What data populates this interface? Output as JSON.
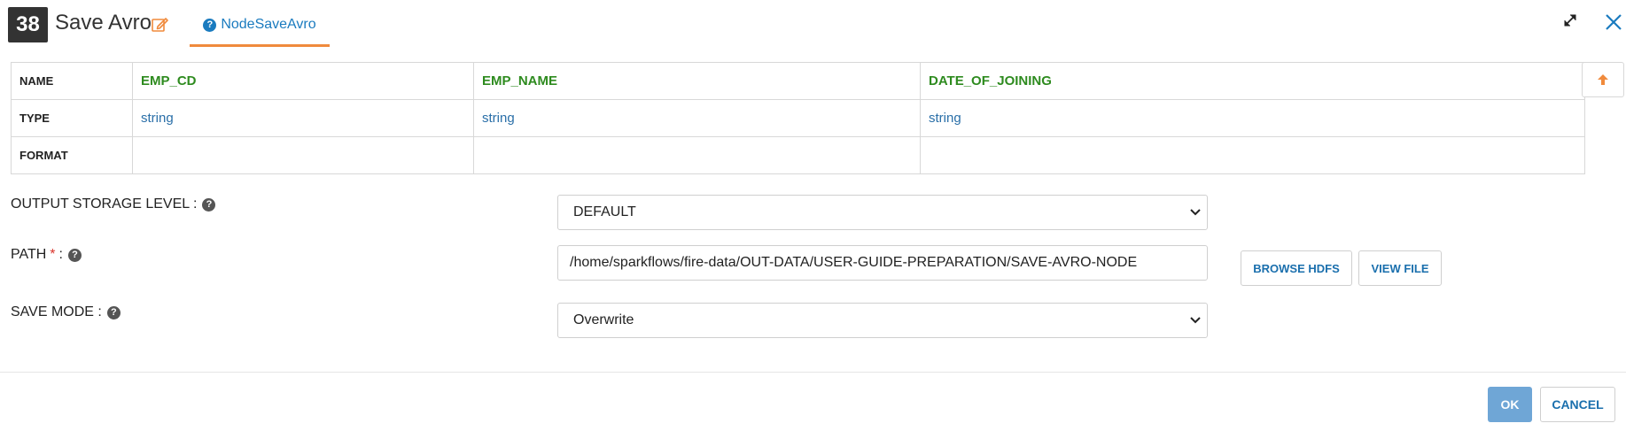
{
  "header": {
    "node_number": "38",
    "node_title": "Save Avro",
    "tab_label": "NodeSaveAvro"
  },
  "schema": {
    "row_labels": [
      "NAME",
      "TYPE",
      "FORMAT"
    ],
    "columns": [
      {
        "name": "EMP_CD",
        "type": "string",
        "format": ""
      },
      {
        "name": "EMP_NAME",
        "type": "string",
        "format": ""
      },
      {
        "name": "DATE_OF_JOINING",
        "type": "string",
        "format": ""
      }
    ]
  },
  "form": {
    "storage_level": {
      "label": "OUTPUT STORAGE LEVEL :",
      "value": "DEFAULT"
    },
    "path": {
      "label": "PATH",
      "required_mark": "*",
      "suffix": ":",
      "value": "/home/sparkflows/fire-data/OUT-DATA/USER-GUIDE-PREPARATION/SAVE-AVRO-NODE"
    },
    "save_mode": {
      "label": "SAVE MODE :",
      "value": "Overwrite"
    },
    "browse_hdfs_label": "BROWSE HDFS",
    "view_file_label": "VIEW FILE"
  },
  "footer": {
    "ok_label": "OK",
    "cancel_label": "CANCEL"
  },
  "colors": {
    "accent_orange": "#f08a3c",
    "link_blue": "#1a7bbf",
    "column_green": "#2e8b1f",
    "ok_blue": "#6fa6d6"
  }
}
